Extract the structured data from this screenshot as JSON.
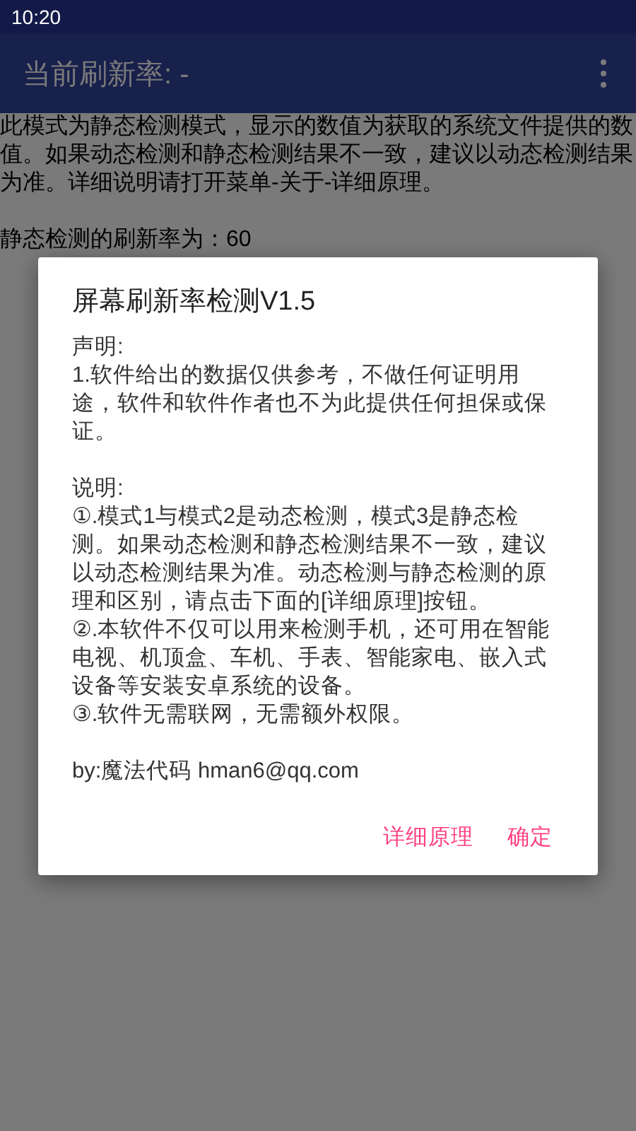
{
  "status_bar": {
    "time": "10:20"
  },
  "app_bar": {
    "title": "当前刷新率: -"
  },
  "content": {
    "description": "此模式为静态检测模式，显示的数值为获取的系统文件提供的数值。如果动态检测和静态检测结果不一致，建议以动态检测结果为准。详细说明请打开菜单-关于-详细原理。",
    "result": "静态检测的刷新率为：60"
  },
  "dialog": {
    "title": "屏幕刷新率检测V1.5",
    "sections": [
      {
        "heading": "声明:",
        "paragraphs": [
          "1.软件给出的数据仅供参考，不做任何证明用途，软件和软件作者也不为此提供任何担保或保证。"
        ]
      },
      {
        "heading": "说明:",
        "paragraphs": [
          "①.模式1与模式2是动态检测，模式3是静态检测。如果动态检测和静态检测结果不一致，建议以动态检测结果为准。动态检测与静态检测的原理和区别，请点击下面的[详细原理]按钮。",
          "②.本软件不仅可以用来检测手机，还可用在智能电视、机顶盒、车机、手表、智能家电、嵌入式设备等安装安卓系统的设备。",
          "③.软件无需联网，无需额外权限。"
        ]
      },
      {
        "heading": "by:魔法代码 hman6@qq.com"
      }
    ],
    "buttons": [
      "详细原理",
      "确定"
    ]
  }
}
